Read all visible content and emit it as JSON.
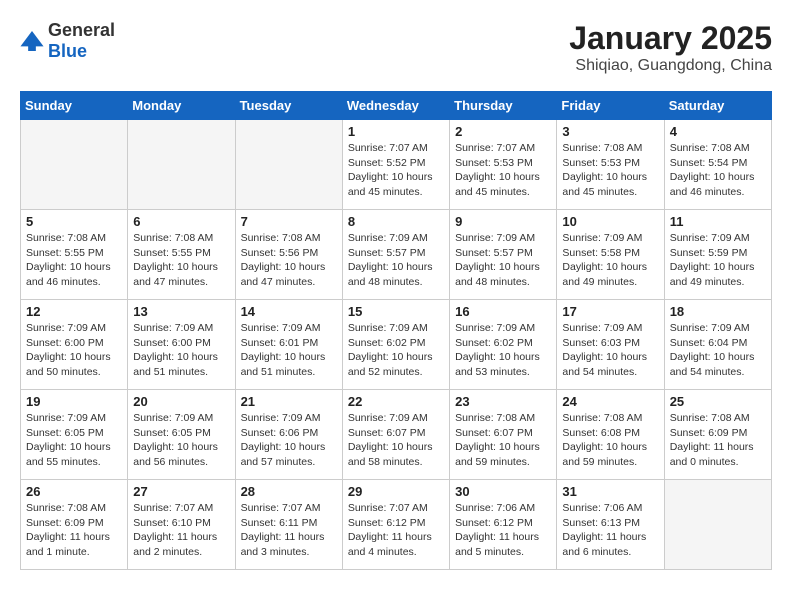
{
  "header": {
    "logo_general": "General",
    "logo_blue": "Blue",
    "title": "January 2025",
    "location": "Shiqiao, Guangdong, China"
  },
  "weekdays": [
    "Sunday",
    "Monday",
    "Tuesday",
    "Wednesday",
    "Thursday",
    "Friday",
    "Saturday"
  ],
  "weeks": [
    [
      {
        "day": "",
        "sunrise": "",
        "sunset": "",
        "daylight": ""
      },
      {
        "day": "",
        "sunrise": "",
        "sunset": "",
        "daylight": ""
      },
      {
        "day": "",
        "sunrise": "",
        "sunset": "",
        "daylight": ""
      },
      {
        "day": "1",
        "sunrise": "Sunrise: 7:07 AM",
        "sunset": "Sunset: 5:52 PM",
        "daylight": "Daylight: 10 hours and 45 minutes."
      },
      {
        "day": "2",
        "sunrise": "Sunrise: 7:07 AM",
        "sunset": "Sunset: 5:53 PM",
        "daylight": "Daylight: 10 hours and 45 minutes."
      },
      {
        "day": "3",
        "sunrise": "Sunrise: 7:08 AM",
        "sunset": "Sunset: 5:53 PM",
        "daylight": "Daylight: 10 hours and 45 minutes."
      },
      {
        "day": "4",
        "sunrise": "Sunrise: 7:08 AM",
        "sunset": "Sunset: 5:54 PM",
        "daylight": "Daylight: 10 hours and 46 minutes."
      }
    ],
    [
      {
        "day": "5",
        "sunrise": "Sunrise: 7:08 AM",
        "sunset": "Sunset: 5:55 PM",
        "daylight": "Daylight: 10 hours and 46 minutes."
      },
      {
        "day": "6",
        "sunrise": "Sunrise: 7:08 AM",
        "sunset": "Sunset: 5:55 PM",
        "daylight": "Daylight: 10 hours and 47 minutes."
      },
      {
        "day": "7",
        "sunrise": "Sunrise: 7:08 AM",
        "sunset": "Sunset: 5:56 PM",
        "daylight": "Daylight: 10 hours and 47 minutes."
      },
      {
        "day": "8",
        "sunrise": "Sunrise: 7:09 AM",
        "sunset": "Sunset: 5:57 PM",
        "daylight": "Daylight: 10 hours and 48 minutes."
      },
      {
        "day": "9",
        "sunrise": "Sunrise: 7:09 AM",
        "sunset": "Sunset: 5:57 PM",
        "daylight": "Daylight: 10 hours and 48 minutes."
      },
      {
        "day": "10",
        "sunrise": "Sunrise: 7:09 AM",
        "sunset": "Sunset: 5:58 PM",
        "daylight": "Daylight: 10 hours and 49 minutes."
      },
      {
        "day": "11",
        "sunrise": "Sunrise: 7:09 AM",
        "sunset": "Sunset: 5:59 PM",
        "daylight": "Daylight: 10 hours and 49 minutes."
      }
    ],
    [
      {
        "day": "12",
        "sunrise": "Sunrise: 7:09 AM",
        "sunset": "Sunset: 6:00 PM",
        "daylight": "Daylight: 10 hours and 50 minutes."
      },
      {
        "day": "13",
        "sunrise": "Sunrise: 7:09 AM",
        "sunset": "Sunset: 6:00 PM",
        "daylight": "Daylight: 10 hours and 51 minutes."
      },
      {
        "day": "14",
        "sunrise": "Sunrise: 7:09 AM",
        "sunset": "Sunset: 6:01 PM",
        "daylight": "Daylight: 10 hours and 51 minutes."
      },
      {
        "day": "15",
        "sunrise": "Sunrise: 7:09 AM",
        "sunset": "Sunset: 6:02 PM",
        "daylight": "Daylight: 10 hours and 52 minutes."
      },
      {
        "day": "16",
        "sunrise": "Sunrise: 7:09 AM",
        "sunset": "Sunset: 6:02 PM",
        "daylight": "Daylight: 10 hours and 53 minutes."
      },
      {
        "day": "17",
        "sunrise": "Sunrise: 7:09 AM",
        "sunset": "Sunset: 6:03 PM",
        "daylight": "Daylight: 10 hours and 54 minutes."
      },
      {
        "day": "18",
        "sunrise": "Sunrise: 7:09 AM",
        "sunset": "Sunset: 6:04 PM",
        "daylight": "Daylight: 10 hours and 54 minutes."
      }
    ],
    [
      {
        "day": "19",
        "sunrise": "Sunrise: 7:09 AM",
        "sunset": "Sunset: 6:05 PM",
        "daylight": "Daylight: 10 hours and 55 minutes."
      },
      {
        "day": "20",
        "sunrise": "Sunrise: 7:09 AM",
        "sunset": "Sunset: 6:05 PM",
        "daylight": "Daylight: 10 hours and 56 minutes."
      },
      {
        "day": "21",
        "sunrise": "Sunrise: 7:09 AM",
        "sunset": "Sunset: 6:06 PM",
        "daylight": "Daylight: 10 hours and 57 minutes."
      },
      {
        "day": "22",
        "sunrise": "Sunrise: 7:09 AM",
        "sunset": "Sunset: 6:07 PM",
        "daylight": "Daylight: 10 hours and 58 minutes."
      },
      {
        "day": "23",
        "sunrise": "Sunrise: 7:08 AM",
        "sunset": "Sunset: 6:07 PM",
        "daylight": "Daylight: 10 hours and 59 minutes."
      },
      {
        "day": "24",
        "sunrise": "Sunrise: 7:08 AM",
        "sunset": "Sunset: 6:08 PM",
        "daylight": "Daylight: 10 hours and 59 minutes."
      },
      {
        "day": "25",
        "sunrise": "Sunrise: 7:08 AM",
        "sunset": "Sunset: 6:09 PM",
        "daylight": "Daylight: 11 hours and 0 minutes."
      }
    ],
    [
      {
        "day": "26",
        "sunrise": "Sunrise: 7:08 AM",
        "sunset": "Sunset: 6:09 PM",
        "daylight": "Daylight: 11 hours and 1 minute."
      },
      {
        "day": "27",
        "sunrise": "Sunrise: 7:07 AM",
        "sunset": "Sunset: 6:10 PM",
        "daylight": "Daylight: 11 hours and 2 minutes."
      },
      {
        "day": "28",
        "sunrise": "Sunrise: 7:07 AM",
        "sunset": "Sunset: 6:11 PM",
        "daylight": "Daylight: 11 hours and 3 minutes."
      },
      {
        "day": "29",
        "sunrise": "Sunrise: 7:07 AM",
        "sunset": "Sunset: 6:12 PM",
        "daylight": "Daylight: 11 hours and 4 minutes."
      },
      {
        "day": "30",
        "sunrise": "Sunrise: 7:06 AM",
        "sunset": "Sunset: 6:12 PM",
        "daylight": "Daylight: 11 hours and 5 minutes."
      },
      {
        "day": "31",
        "sunrise": "Sunrise: 7:06 AM",
        "sunset": "Sunset: 6:13 PM",
        "daylight": "Daylight: 11 hours and 6 minutes."
      },
      {
        "day": "",
        "sunrise": "",
        "sunset": "",
        "daylight": ""
      }
    ]
  ]
}
